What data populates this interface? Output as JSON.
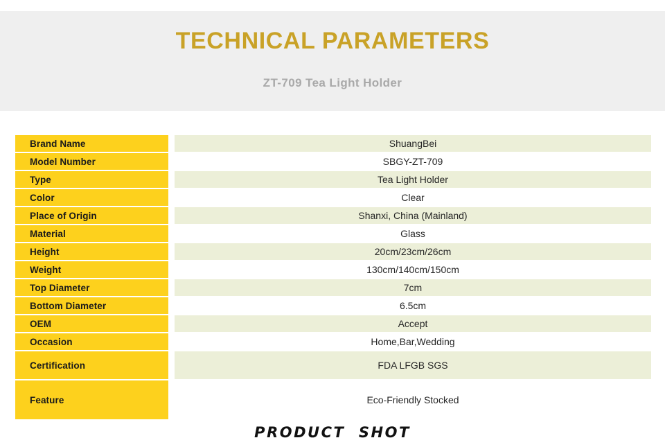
{
  "header": {
    "title": "TECHNICAL PARAMETERS",
    "subtitle": "ZT-709  Tea Light Holder",
    "title_color": "#c9a227",
    "subtitle_color": "#a9a9a9",
    "band_color": "#efefef"
  },
  "colors": {
    "label_yellow": "#fdd11d",
    "value_green": "#ecefd8",
    "value_white": "#ffffff",
    "text_dark": "#1a1a1a"
  },
  "spec_table": {
    "rows": [
      {
        "label": "Brand Name",
        "value": "ShuangBei"
      },
      {
        "label": "Model Number",
        "value": "SBGY-ZT-709"
      },
      {
        "label": "Type",
        "value": "Tea Light Holder"
      },
      {
        "label": "Color",
        "value": "Clear"
      },
      {
        "label": "Place of Origin",
        "value": "Shanxi, China (Mainland)"
      },
      {
        "label": "Material",
        "value": "Glass"
      },
      {
        "label": "Height",
        "value": "20cm/23cm/26cm"
      },
      {
        "label": "Weight",
        "value": "130cm/140cm/150cm"
      },
      {
        "label": "Top Diameter",
        "value": "7cm"
      },
      {
        "label": "Bottom Diameter",
        "value": "6.5cm"
      },
      {
        "label": "OEM",
        "value": "Accept"
      },
      {
        "label": "Occasion",
        "value": "Home,Bar,Wedding"
      },
      {
        "label": "Certification",
        "value": "FDA  LFGB  SGS"
      },
      {
        "label": "Feature",
        "value": "Eco-Friendly    Stocked"
      }
    ]
  },
  "footer": {
    "caption": "PRODUCT  SHOT"
  }
}
